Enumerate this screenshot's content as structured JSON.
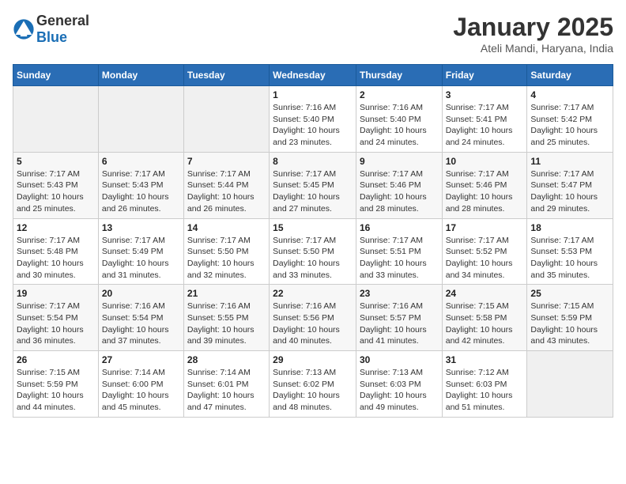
{
  "header": {
    "logo_general": "General",
    "logo_blue": "Blue",
    "title": "January 2025",
    "subtitle": "Ateli Mandi, Haryana, India"
  },
  "days_of_week": [
    "Sunday",
    "Monday",
    "Tuesday",
    "Wednesday",
    "Thursday",
    "Friday",
    "Saturday"
  ],
  "weeks": [
    [
      {
        "day": "",
        "info": ""
      },
      {
        "day": "",
        "info": ""
      },
      {
        "day": "",
        "info": ""
      },
      {
        "day": "1",
        "sunrise": "Sunrise: 7:16 AM",
        "sunset": "Sunset: 5:40 PM",
        "daylight": "Daylight: 10 hours and 23 minutes."
      },
      {
        "day": "2",
        "sunrise": "Sunrise: 7:16 AM",
        "sunset": "Sunset: 5:40 PM",
        "daylight": "Daylight: 10 hours and 24 minutes."
      },
      {
        "day": "3",
        "sunrise": "Sunrise: 7:17 AM",
        "sunset": "Sunset: 5:41 PM",
        "daylight": "Daylight: 10 hours and 24 minutes."
      },
      {
        "day": "4",
        "sunrise": "Sunrise: 7:17 AM",
        "sunset": "Sunset: 5:42 PM",
        "daylight": "Daylight: 10 hours and 25 minutes."
      }
    ],
    [
      {
        "day": "5",
        "sunrise": "Sunrise: 7:17 AM",
        "sunset": "Sunset: 5:43 PM",
        "daylight": "Daylight: 10 hours and 25 minutes."
      },
      {
        "day": "6",
        "sunrise": "Sunrise: 7:17 AM",
        "sunset": "Sunset: 5:43 PM",
        "daylight": "Daylight: 10 hours and 26 minutes."
      },
      {
        "day": "7",
        "sunrise": "Sunrise: 7:17 AM",
        "sunset": "Sunset: 5:44 PM",
        "daylight": "Daylight: 10 hours and 26 minutes."
      },
      {
        "day": "8",
        "sunrise": "Sunrise: 7:17 AM",
        "sunset": "Sunset: 5:45 PM",
        "daylight": "Daylight: 10 hours and 27 minutes."
      },
      {
        "day": "9",
        "sunrise": "Sunrise: 7:17 AM",
        "sunset": "Sunset: 5:46 PM",
        "daylight": "Daylight: 10 hours and 28 minutes."
      },
      {
        "day": "10",
        "sunrise": "Sunrise: 7:17 AM",
        "sunset": "Sunset: 5:46 PM",
        "daylight": "Daylight: 10 hours and 28 minutes."
      },
      {
        "day": "11",
        "sunrise": "Sunrise: 7:17 AM",
        "sunset": "Sunset: 5:47 PM",
        "daylight": "Daylight: 10 hours and 29 minutes."
      }
    ],
    [
      {
        "day": "12",
        "sunrise": "Sunrise: 7:17 AM",
        "sunset": "Sunset: 5:48 PM",
        "daylight": "Daylight: 10 hours and 30 minutes."
      },
      {
        "day": "13",
        "sunrise": "Sunrise: 7:17 AM",
        "sunset": "Sunset: 5:49 PM",
        "daylight": "Daylight: 10 hours and 31 minutes."
      },
      {
        "day": "14",
        "sunrise": "Sunrise: 7:17 AM",
        "sunset": "Sunset: 5:50 PM",
        "daylight": "Daylight: 10 hours and 32 minutes."
      },
      {
        "day": "15",
        "sunrise": "Sunrise: 7:17 AM",
        "sunset": "Sunset: 5:50 PM",
        "daylight": "Daylight: 10 hours and 33 minutes."
      },
      {
        "day": "16",
        "sunrise": "Sunrise: 7:17 AM",
        "sunset": "Sunset: 5:51 PM",
        "daylight": "Daylight: 10 hours and 33 minutes."
      },
      {
        "day": "17",
        "sunrise": "Sunrise: 7:17 AM",
        "sunset": "Sunset: 5:52 PM",
        "daylight": "Daylight: 10 hours and 34 minutes."
      },
      {
        "day": "18",
        "sunrise": "Sunrise: 7:17 AM",
        "sunset": "Sunset: 5:53 PM",
        "daylight": "Daylight: 10 hours and 35 minutes."
      }
    ],
    [
      {
        "day": "19",
        "sunrise": "Sunrise: 7:17 AM",
        "sunset": "Sunset: 5:54 PM",
        "daylight": "Daylight: 10 hours and 36 minutes."
      },
      {
        "day": "20",
        "sunrise": "Sunrise: 7:16 AM",
        "sunset": "Sunset: 5:54 PM",
        "daylight": "Daylight: 10 hours and 37 minutes."
      },
      {
        "day": "21",
        "sunrise": "Sunrise: 7:16 AM",
        "sunset": "Sunset: 5:55 PM",
        "daylight": "Daylight: 10 hours and 39 minutes."
      },
      {
        "day": "22",
        "sunrise": "Sunrise: 7:16 AM",
        "sunset": "Sunset: 5:56 PM",
        "daylight": "Daylight: 10 hours and 40 minutes."
      },
      {
        "day": "23",
        "sunrise": "Sunrise: 7:16 AM",
        "sunset": "Sunset: 5:57 PM",
        "daylight": "Daylight: 10 hours and 41 minutes."
      },
      {
        "day": "24",
        "sunrise": "Sunrise: 7:15 AM",
        "sunset": "Sunset: 5:58 PM",
        "daylight": "Daylight: 10 hours and 42 minutes."
      },
      {
        "day": "25",
        "sunrise": "Sunrise: 7:15 AM",
        "sunset": "Sunset: 5:59 PM",
        "daylight": "Daylight: 10 hours and 43 minutes."
      }
    ],
    [
      {
        "day": "26",
        "sunrise": "Sunrise: 7:15 AM",
        "sunset": "Sunset: 5:59 PM",
        "daylight": "Daylight: 10 hours and 44 minutes."
      },
      {
        "day": "27",
        "sunrise": "Sunrise: 7:14 AM",
        "sunset": "Sunset: 6:00 PM",
        "daylight": "Daylight: 10 hours and 45 minutes."
      },
      {
        "day": "28",
        "sunrise": "Sunrise: 7:14 AM",
        "sunset": "Sunset: 6:01 PM",
        "daylight": "Daylight: 10 hours and 47 minutes."
      },
      {
        "day": "29",
        "sunrise": "Sunrise: 7:13 AM",
        "sunset": "Sunset: 6:02 PM",
        "daylight": "Daylight: 10 hours and 48 minutes."
      },
      {
        "day": "30",
        "sunrise": "Sunrise: 7:13 AM",
        "sunset": "Sunset: 6:03 PM",
        "daylight": "Daylight: 10 hours and 49 minutes."
      },
      {
        "day": "31",
        "sunrise": "Sunrise: 7:12 AM",
        "sunset": "Sunset: 6:03 PM",
        "daylight": "Daylight: 10 hours and 51 minutes."
      },
      {
        "day": "",
        "info": ""
      }
    ]
  ]
}
